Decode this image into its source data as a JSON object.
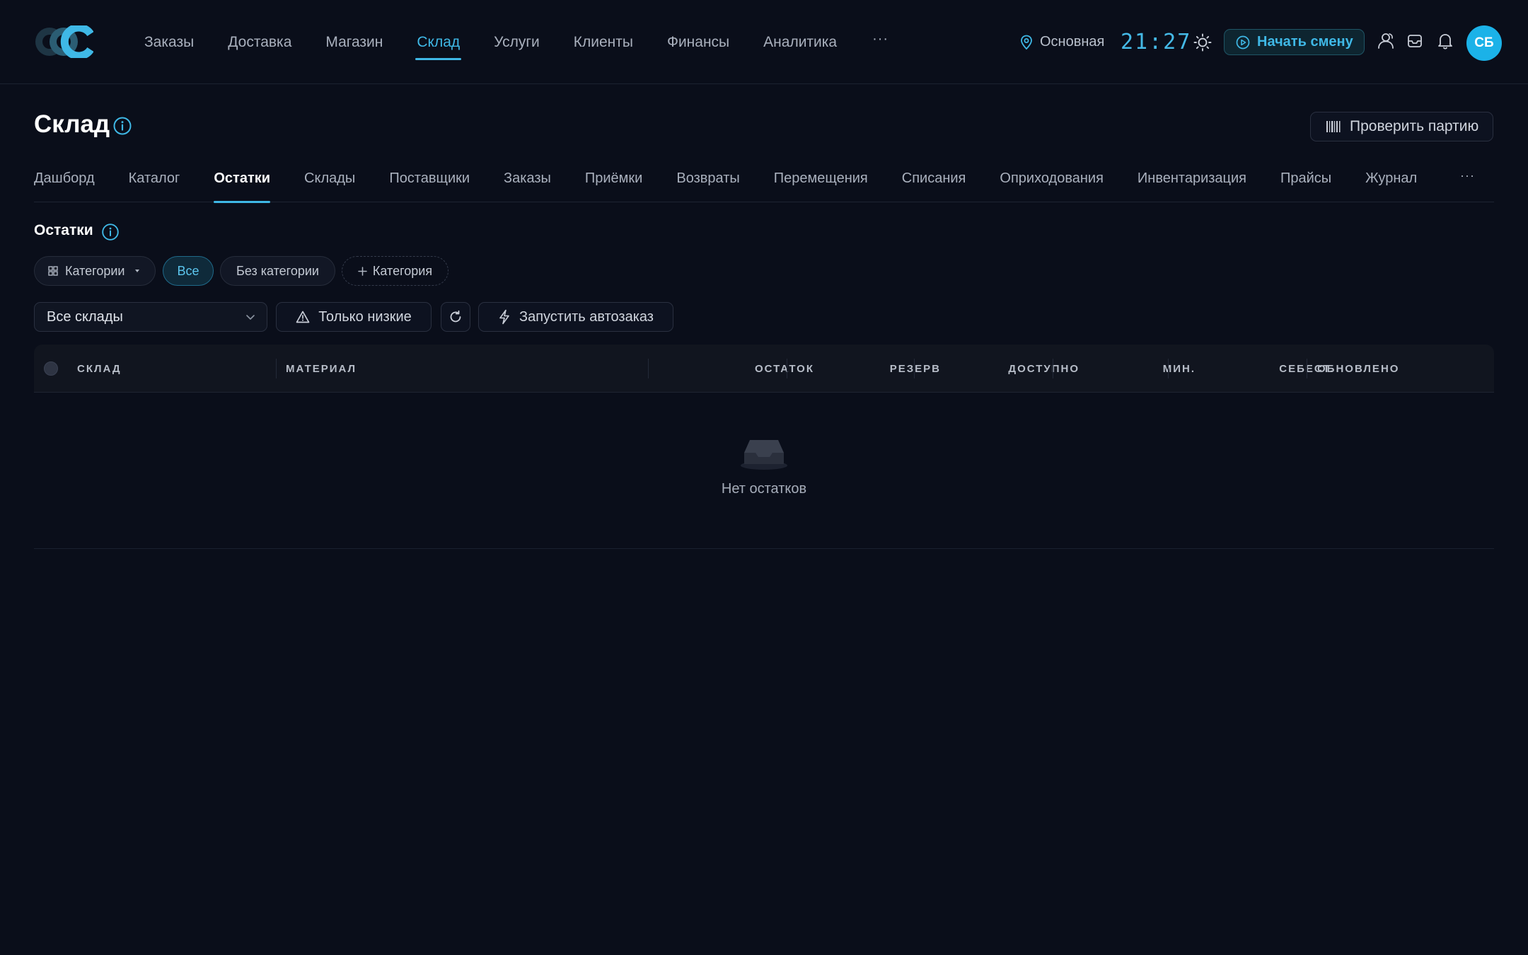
{
  "header": {
    "nav": [
      "Заказы",
      "Доставка",
      "Магазин",
      "Склад",
      "Услуги",
      "Клиенты",
      "Финансы",
      "Аналитика"
    ],
    "nav_active": "Склад",
    "nav_more": "···",
    "location": "Основная",
    "clock": "21:27",
    "shift_button": "Начать смену",
    "avatar_initials": "СБ"
  },
  "page": {
    "title": "Склад",
    "check_batch_button": "Проверить партию"
  },
  "subtabs": [
    "Дашборд",
    "Каталог",
    "Остатки",
    "Склады",
    "Поставщики",
    "Заказы",
    "Приёмки",
    "Возвраты",
    "Перемещения",
    "Списания",
    "Оприходования",
    "Инвентаризация",
    "Прайсы",
    "Журнал"
  ],
  "subtab_active": "Остатки",
  "subtab_more": "···",
  "section": {
    "title": "Остатки",
    "chips": {
      "categories": "Категории",
      "all": "Все",
      "no_category": "Без категории",
      "add_category": "Категория"
    },
    "warehouse_select": "Все склады",
    "only_low_button": "Только низкие",
    "autoorder_button": "Запустить автозаказ"
  },
  "table": {
    "columns": {
      "warehouse": "СКЛАД",
      "material": "МАТЕРИАЛ",
      "stock": "ОСТАТОК",
      "reserve": "РЕЗЕРВ",
      "available": "ДОСТУПНО",
      "min": "МИН.",
      "cost": "СЕБЕСТ.",
      "updated": "ОБНОВЛЕНО"
    },
    "empty_text": "Нет остатков"
  },
  "colors": {
    "background": "#0a0e1a",
    "accent": "#3fb8e6",
    "avatar": "#1bb2e8"
  }
}
